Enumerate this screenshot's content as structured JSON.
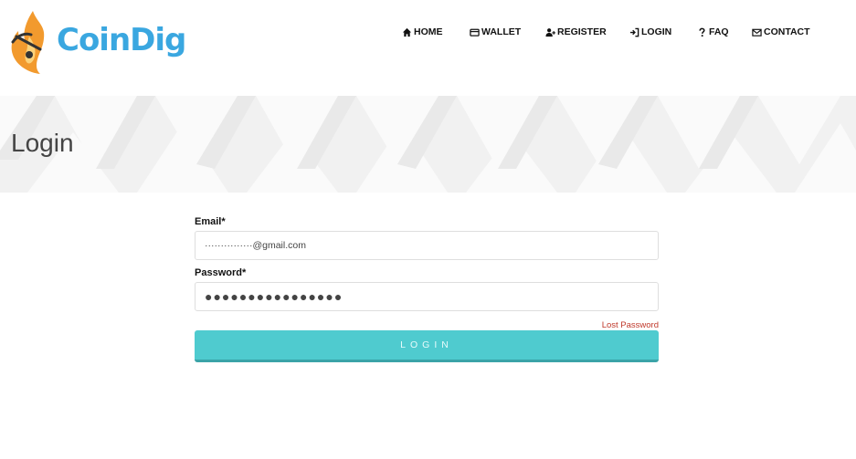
{
  "brand": {
    "name": "CoinDig",
    "color": "#3aa7e0",
    "flame_color": "#f29a2e"
  },
  "nav": {
    "items": [
      {
        "label": "HOME",
        "icon": "home-icon"
      },
      {
        "label": "WALLET",
        "icon": "wallet-icon"
      },
      {
        "label": "REGISTER",
        "icon": "user-plus-icon"
      },
      {
        "label": "LOGIN",
        "icon": "sign-in-icon"
      },
      {
        "label": "FAQ",
        "icon": "question-icon"
      },
      {
        "label": "CONTACT",
        "icon": "envelope-icon"
      }
    ]
  },
  "banner": {
    "title": "Login"
  },
  "form": {
    "email_label": "Email*",
    "email_value": "···············@gmail.com",
    "password_label": "Password*",
    "password_value": "●●●●●●●●●●●●●●●●",
    "lost_password": "Lost Password",
    "login_button": "LOGIN",
    "button_color": "#4fcbcf",
    "link_color": "#c0392b"
  }
}
